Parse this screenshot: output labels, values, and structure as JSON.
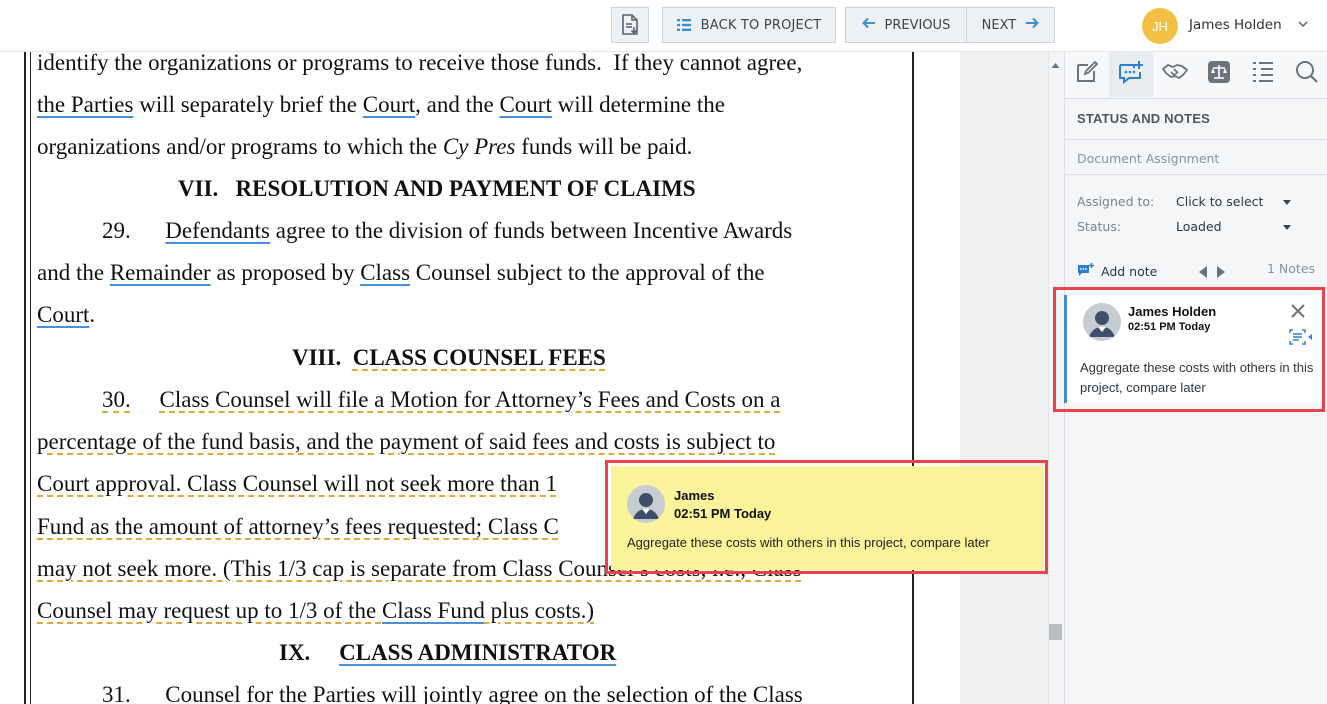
{
  "toolbar": {
    "back_label": "BACK TO PROJECT",
    "prev_label": "PREVIOUS",
    "next_label": "NEXT"
  },
  "user": {
    "initials": "JH",
    "name": "James Holden",
    "avatar_color": "#f2c043"
  },
  "document": {
    "lines": [
      [
        {
          "t": "identify the organizations or programs to receive those funds.  If they cannot agree,"
        }
      ],
      [
        {
          "t": "the Parties",
          "s": "u"
        },
        {
          "t": " will separately brief the "
        },
        {
          "t": "Court",
          "s": "u"
        },
        {
          "t": ", and the "
        },
        {
          "t": "Court",
          "s": "u"
        },
        {
          "t": " will determine the"
        }
      ],
      [
        {
          "t": "organizations and/or programs to which the "
        },
        {
          "t": "Cy Pres",
          "s": "i"
        },
        {
          "t": " funds will be paid."
        }
      ],
      [
        {
          "t": "VII.   RESOLUTION AND PAYMENT OF CLAIMS",
          "s": "b"
        }
      ],
      [
        {
          "t": "29.      "
        },
        {
          "t": "Defendants",
          "s": "u"
        },
        {
          "t": " agree to the division of funds between Incentive Awards"
        }
      ],
      [
        {
          "t": "and the "
        },
        {
          "t": "Remainder",
          "s": "u"
        },
        {
          "t": " as proposed by "
        },
        {
          "t": "Class",
          "s": "u"
        },
        {
          "t": " Counsel subject to the approval of the"
        }
      ],
      [
        {
          "t": "Court",
          "s": "u"
        },
        {
          "t": "."
        }
      ],
      [
        {
          "t": "VIII.  ",
          "s": "b"
        },
        {
          "t": "CLASS COUNSEL FEES",
          "s": "bd"
        }
      ],
      [
        {
          "t": "30.",
          "s": "d"
        },
        {
          "t": "     "
        },
        {
          "t": "Class Counsel will file a Motion for Attorney’s Fees and Costs on a",
          "s": "d"
        }
      ],
      [
        {
          "t": "percentage of the fund basis, and the payment of said fees and costs is subject to",
          "s": "d"
        }
      ],
      [
        {
          "t": "Court approval. Class Counsel will not seek more than 1",
          "s": "d"
        }
      ],
      [
        {
          "t": "Fund as the amount of attorney’s fees requested; Class C",
          "s": "d"
        }
      ],
      [
        {
          "t": "may not seek more. (This 1/3 cap is separate from Class Counsel’s costs, i.e., Class",
          "s": "d"
        }
      ],
      [
        {
          "t": "Counsel may request up to 1/3 of the ",
          "s": "d"
        },
        {
          "t": "Class Fund",
          "s": "u"
        },
        {
          "t": " plus costs.)",
          "s": "d"
        }
      ],
      [
        {
          "t": "IX.     ",
          "s": "b"
        },
        {
          "t": "CLASS ADMINISTRATOR",
          "s": "bu"
        }
      ],
      [
        {
          "t": "31.      Counsel for the Parties will jointly agree on the selection of the Class"
        }
      ]
    ]
  },
  "panel": {
    "section_title": "STATUS AND NOTES",
    "doc_assignment": "Document Assignment",
    "assigned_label": "Assigned to:",
    "assigned_value": "Click to select",
    "status_label": "Status:",
    "status_value": "Loaded",
    "add_note": "Add note",
    "notes_count": "1 Notes"
  },
  "note": {
    "author": "James Holden",
    "time": "02:51 PM Today",
    "text": "Aggregate these costs with others in this project, compare later"
  },
  "popup": {
    "author": "James",
    "time": "02:51 PM Today",
    "text": "Aggregate these costs with others in this project, compare later"
  },
  "colors": {
    "highlight": "#e6434a",
    "popup_bg": "#fbf39a",
    "note_accent": "#3a8fd6",
    "link_underline": "#4a90d9",
    "dashed_underline": "#e0a93a"
  }
}
